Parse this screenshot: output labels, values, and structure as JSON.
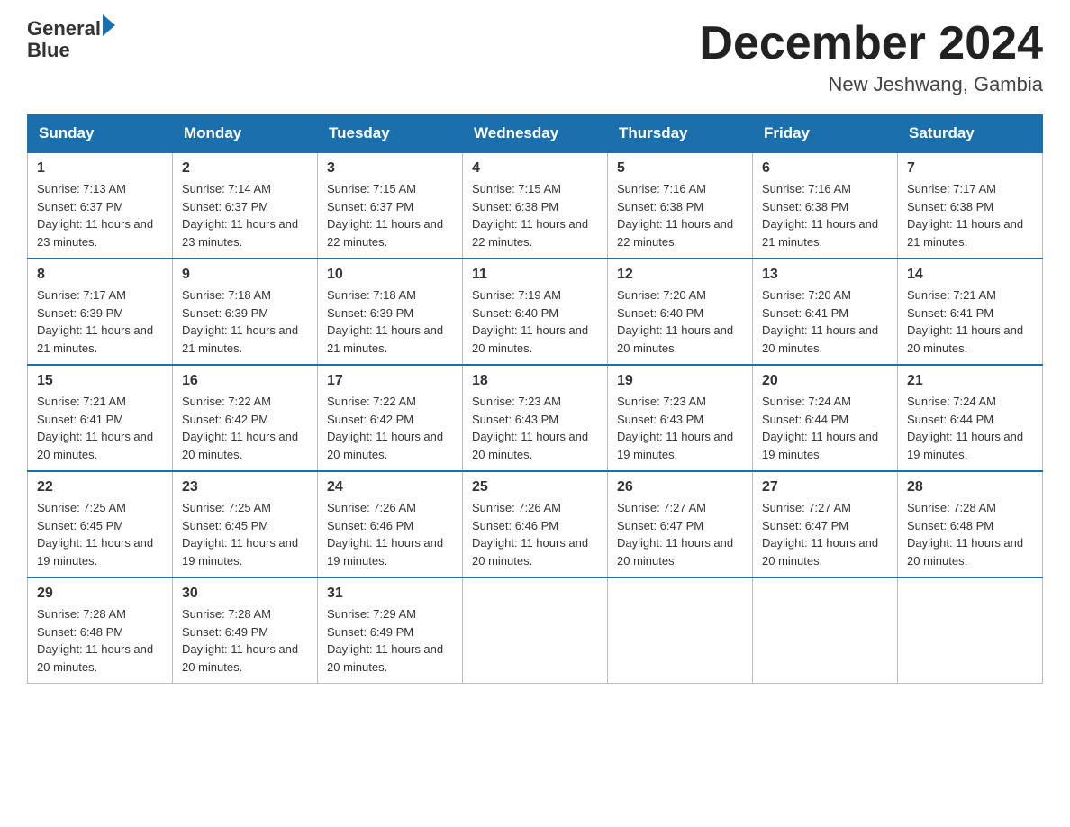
{
  "header": {
    "logo": {
      "line1": "General",
      "line2": "Blue"
    },
    "title": "December 2024",
    "location": "New Jeshwang, Gambia"
  },
  "days_of_week": [
    "Sunday",
    "Monday",
    "Tuesday",
    "Wednesday",
    "Thursday",
    "Friday",
    "Saturday"
  ],
  "weeks": [
    [
      {
        "day": "1",
        "sunrise": "7:13 AM",
        "sunset": "6:37 PM",
        "daylight": "11 hours and 23 minutes."
      },
      {
        "day": "2",
        "sunrise": "7:14 AM",
        "sunset": "6:37 PM",
        "daylight": "11 hours and 23 minutes."
      },
      {
        "day": "3",
        "sunrise": "7:15 AM",
        "sunset": "6:37 PM",
        "daylight": "11 hours and 22 minutes."
      },
      {
        "day": "4",
        "sunrise": "7:15 AM",
        "sunset": "6:38 PM",
        "daylight": "11 hours and 22 minutes."
      },
      {
        "day": "5",
        "sunrise": "7:16 AM",
        "sunset": "6:38 PM",
        "daylight": "11 hours and 22 minutes."
      },
      {
        "day": "6",
        "sunrise": "7:16 AM",
        "sunset": "6:38 PM",
        "daylight": "11 hours and 21 minutes."
      },
      {
        "day": "7",
        "sunrise": "7:17 AM",
        "sunset": "6:38 PM",
        "daylight": "11 hours and 21 minutes."
      }
    ],
    [
      {
        "day": "8",
        "sunrise": "7:17 AM",
        "sunset": "6:39 PM",
        "daylight": "11 hours and 21 minutes."
      },
      {
        "day": "9",
        "sunrise": "7:18 AM",
        "sunset": "6:39 PM",
        "daylight": "11 hours and 21 minutes."
      },
      {
        "day": "10",
        "sunrise": "7:18 AM",
        "sunset": "6:39 PM",
        "daylight": "11 hours and 21 minutes."
      },
      {
        "day": "11",
        "sunrise": "7:19 AM",
        "sunset": "6:40 PM",
        "daylight": "11 hours and 20 minutes."
      },
      {
        "day": "12",
        "sunrise": "7:20 AM",
        "sunset": "6:40 PM",
        "daylight": "11 hours and 20 minutes."
      },
      {
        "day": "13",
        "sunrise": "7:20 AM",
        "sunset": "6:41 PM",
        "daylight": "11 hours and 20 minutes."
      },
      {
        "day": "14",
        "sunrise": "7:21 AM",
        "sunset": "6:41 PM",
        "daylight": "11 hours and 20 minutes."
      }
    ],
    [
      {
        "day": "15",
        "sunrise": "7:21 AM",
        "sunset": "6:41 PM",
        "daylight": "11 hours and 20 minutes."
      },
      {
        "day": "16",
        "sunrise": "7:22 AM",
        "sunset": "6:42 PM",
        "daylight": "11 hours and 20 minutes."
      },
      {
        "day": "17",
        "sunrise": "7:22 AM",
        "sunset": "6:42 PM",
        "daylight": "11 hours and 20 minutes."
      },
      {
        "day": "18",
        "sunrise": "7:23 AM",
        "sunset": "6:43 PM",
        "daylight": "11 hours and 20 minutes."
      },
      {
        "day": "19",
        "sunrise": "7:23 AM",
        "sunset": "6:43 PM",
        "daylight": "11 hours and 19 minutes."
      },
      {
        "day": "20",
        "sunrise": "7:24 AM",
        "sunset": "6:44 PM",
        "daylight": "11 hours and 19 minutes."
      },
      {
        "day": "21",
        "sunrise": "7:24 AM",
        "sunset": "6:44 PM",
        "daylight": "11 hours and 19 minutes."
      }
    ],
    [
      {
        "day": "22",
        "sunrise": "7:25 AM",
        "sunset": "6:45 PM",
        "daylight": "11 hours and 19 minutes."
      },
      {
        "day": "23",
        "sunrise": "7:25 AM",
        "sunset": "6:45 PM",
        "daylight": "11 hours and 19 minutes."
      },
      {
        "day": "24",
        "sunrise": "7:26 AM",
        "sunset": "6:46 PM",
        "daylight": "11 hours and 19 minutes."
      },
      {
        "day": "25",
        "sunrise": "7:26 AM",
        "sunset": "6:46 PM",
        "daylight": "11 hours and 20 minutes."
      },
      {
        "day": "26",
        "sunrise": "7:27 AM",
        "sunset": "6:47 PM",
        "daylight": "11 hours and 20 minutes."
      },
      {
        "day": "27",
        "sunrise": "7:27 AM",
        "sunset": "6:47 PM",
        "daylight": "11 hours and 20 minutes."
      },
      {
        "day": "28",
        "sunrise": "7:28 AM",
        "sunset": "6:48 PM",
        "daylight": "11 hours and 20 minutes."
      }
    ],
    [
      {
        "day": "29",
        "sunrise": "7:28 AM",
        "sunset": "6:48 PM",
        "daylight": "11 hours and 20 minutes."
      },
      {
        "day": "30",
        "sunrise": "7:28 AM",
        "sunset": "6:49 PM",
        "daylight": "11 hours and 20 minutes."
      },
      {
        "day": "31",
        "sunrise": "7:29 AM",
        "sunset": "6:49 PM",
        "daylight": "11 hours and 20 minutes."
      },
      null,
      null,
      null,
      null
    ]
  ],
  "labels": {
    "sunrise_prefix": "Sunrise: ",
    "sunset_prefix": "Sunset: ",
    "daylight_prefix": "Daylight: "
  }
}
